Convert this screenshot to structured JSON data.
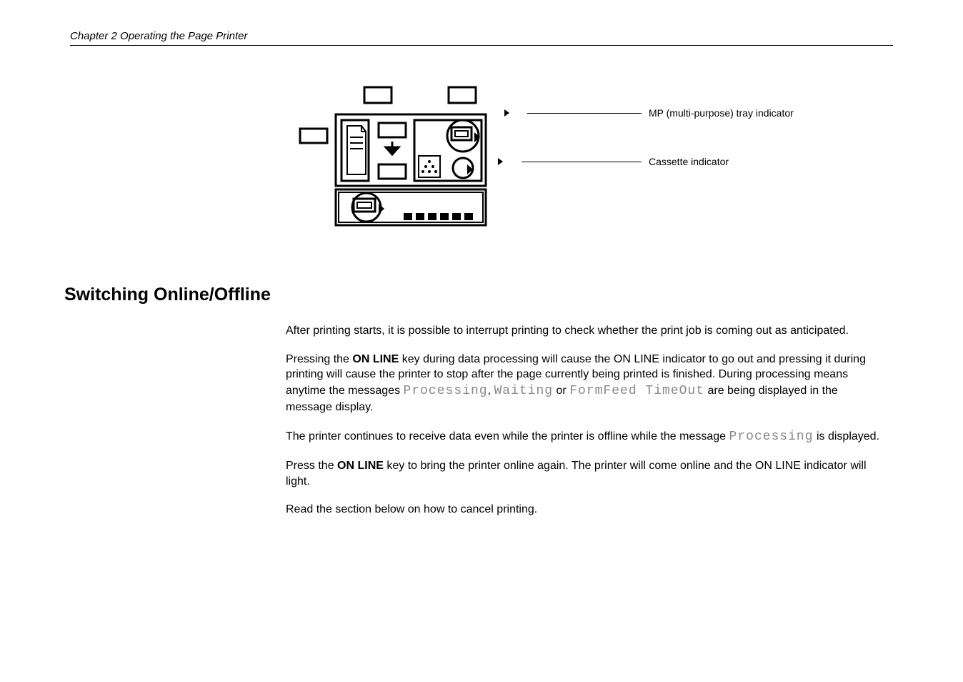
{
  "header": {
    "chapter": "Chapter 2  Operating the Page Printer"
  },
  "diagram": {
    "callout1": "MP (multi-purpose) tray indicator",
    "callout2": "Cassette indicator"
  },
  "section": {
    "heading": "Switching Online/Offline"
  },
  "paragraphs": {
    "p1": "After printing starts, it is possible to interrupt printing to check whether the print job is coming out as anticipated.",
    "p2a": "Pressing the ",
    "p2b": "ON LINE",
    "p2c": " key during data processing will cause the ON LINE indicator to go out and pressing it during printing will cause the printer to stop after the page currently being printed is finished.  During processing means anytime the messages ",
    "p2d": "Processing",
    "p2e": ", ",
    "p2f": "Waiting",
    "p2g": " or ",
    "p2h": "FormFeed TimeOut",
    "p2i": " are being displayed in the message display.",
    "p3a": "The printer continues to receive data even while the printer is offline while the message ",
    "p3b": "Processing",
    "p3c": " is displayed.",
    "p4a": "Press the ",
    "p4b": "ON LINE",
    "p4c": " key to bring the printer online again.  The printer will come online and the ON LINE indicator will light.",
    "p5": "Read the section below on how to cancel printing."
  }
}
